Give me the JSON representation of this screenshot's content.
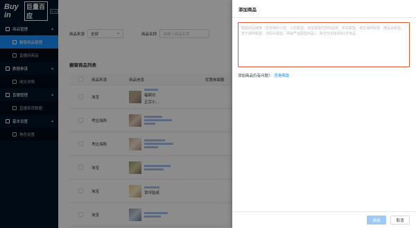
{
  "logo": {
    "text": "Buy in",
    "cn": "巨量百应",
    "badge": "Beta"
  },
  "sidebar": {
    "groups": [
      {
        "label": "商品管理",
        "items": [
          {
            "label": "橱窗商品管理"
          },
          {
            "label": "直播间商品"
          }
        ]
      },
      {
        "label": "数据参谋",
        "items": [
          {
            "label": "成交详情"
          }
        ]
      },
      {
        "label": "直播管理",
        "items": [
          {
            "label": "直播带货数据"
          }
        ]
      },
      {
        "label": "基本设置",
        "items": [
          {
            "label": "角色设置"
          }
        ]
      }
    ]
  },
  "filter": {
    "source_label": "商品来源",
    "source_value": "全部",
    "name_label": "商品名称",
    "name_placeholder": "请输入商品名称"
  },
  "section_title": "橱窗商品列表",
  "table": {
    "headers": [
      "商品来源",
      "商品信息",
      "优惠券面额"
    ],
    "rows": [
      {
        "source": "淘宝",
        "title": "福鼎白",
        "sub": "正宗小..."
      },
      {
        "source": "考拉海购",
        "title": "",
        "sub": ""
      },
      {
        "source": "考拉海购",
        "title": "",
        "sub": ""
      },
      {
        "source": "淘宝",
        "title": "",
        "sub": ""
      },
      {
        "source": "淘宝",
        "title": "草坪贴纸",
        "sub": ""
      },
      {
        "source": "淘宝",
        "title": "",
        "sub": ""
      }
    ]
  },
  "drawer": {
    "title": "添加商品",
    "textarea_placeholder": "粘贴商品链接（支持我的小店、小店联盟、淘宝联盟内容商品库、京东联盟、考拉海购联盟、唯品会联盟、苏宁易购联盟、洋码头联盟、网易严选联盟商品），单次仅支持添加1件商品",
    "help_text": "添加商品仍有问题？",
    "help_link": "查看帮助",
    "confirm_label": "添加",
    "cancel_label": "取消"
  },
  "colors": {
    "accent": "#1890ff",
    "sidebar": "#001529",
    "error_border": "#e0502a"
  }
}
